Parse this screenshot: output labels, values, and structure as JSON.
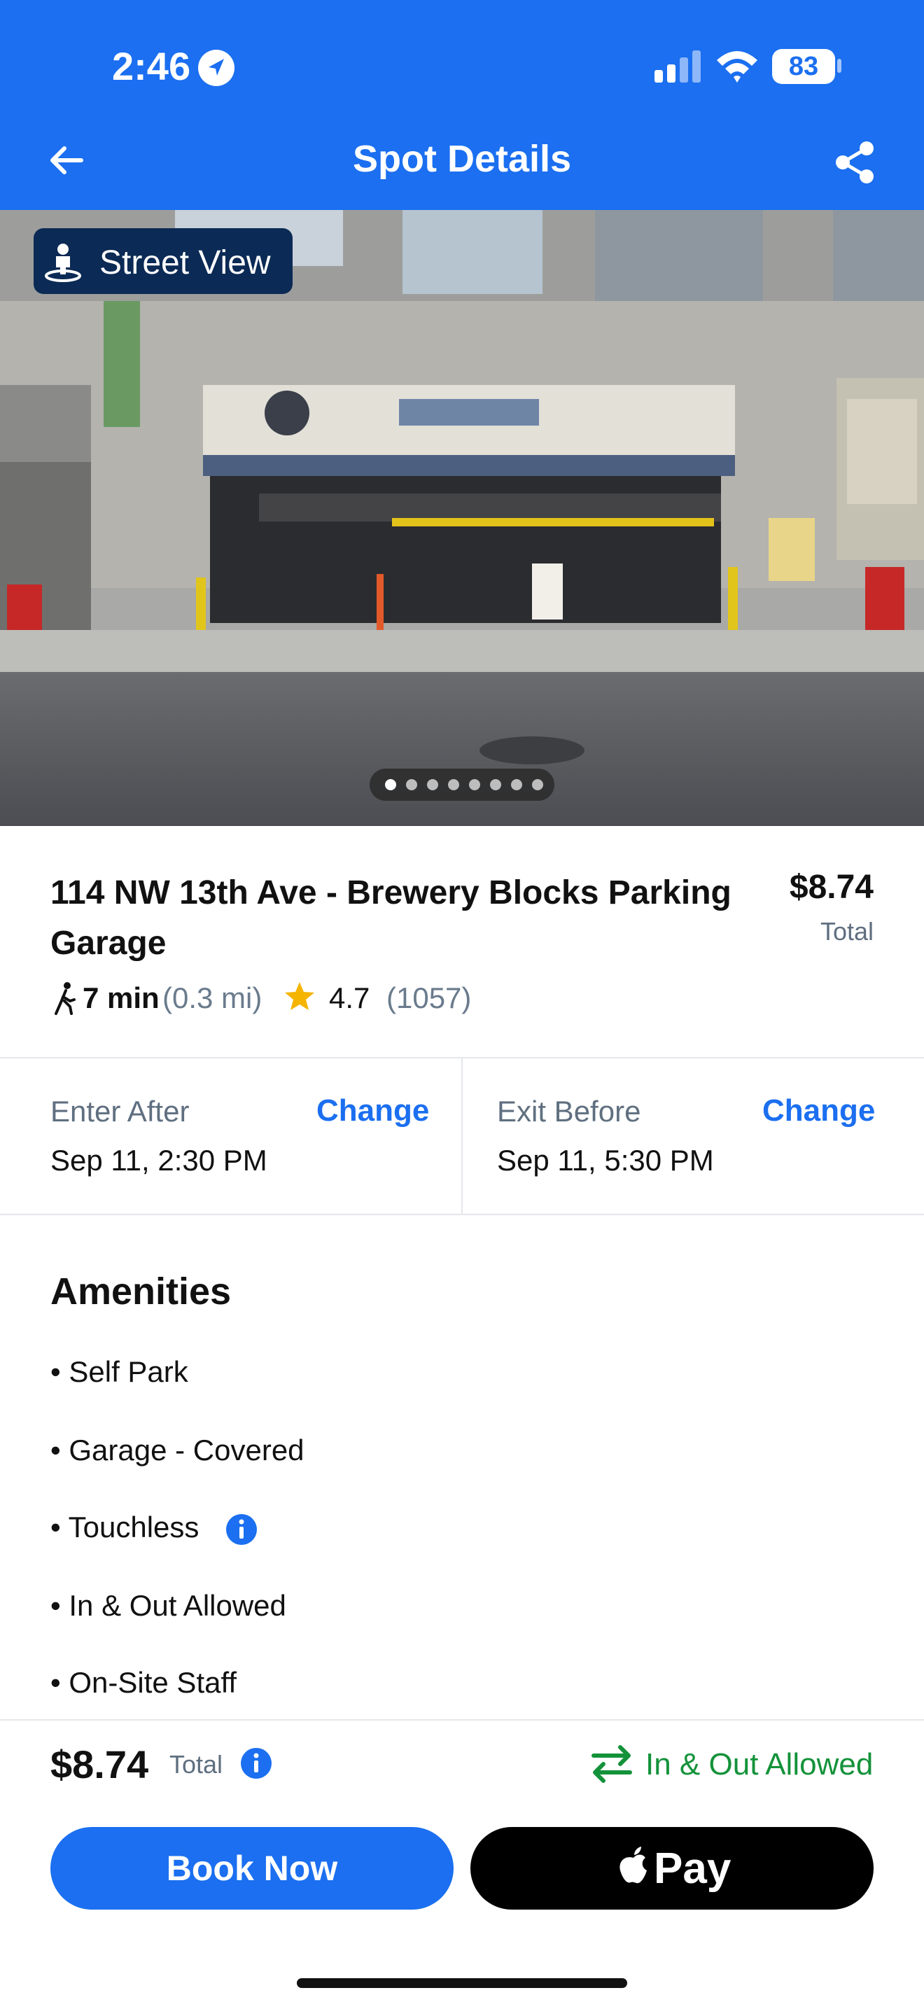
{
  "status_bar": {
    "time": "2:46",
    "battery": "83"
  },
  "header": {
    "title": "Spot Details"
  },
  "photo": {
    "street_view_label": "Street View",
    "carousel_count": 8,
    "carousel_active_index": 0
  },
  "spot": {
    "name": "114 NW 13th Ave - Brewery Blocks Parking Garage",
    "price": "$8.74",
    "price_label": "Total",
    "walk_time": "7 min",
    "walk_distance": "(0.3 mi)",
    "rating": "4.7",
    "review_count": "(1057)"
  },
  "times": {
    "enter": {
      "label": "Enter After",
      "change": "Change",
      "value": "Sep 11, 2:30 PM"
    },
    "exit": {
      "label": "Exit Before",
      "change": "Change",
      "value": "Sep 11, 5:30 PM"
    }
  },
  "amenities": {
    "title": "Amenities",
    "items": [
      "• Self Park",
      "• Garage - Covered",
      "• Touchless",
      "• In & Out Allowed",
      "• On-Site Staff"
    ]
  },
  "bottom_bar": {
    "price": "$8.74",
    "total_label": "Total",
    "in_out_label": "In & Out Allowed",
    "book_label": "Book Now",
    "pay_label": "Pay"
  },
  "colors": {
    "brand_blue": "#1b6ff0",
    "success_green": "#14923a",
    "star": "#f5b400"
  }
}
